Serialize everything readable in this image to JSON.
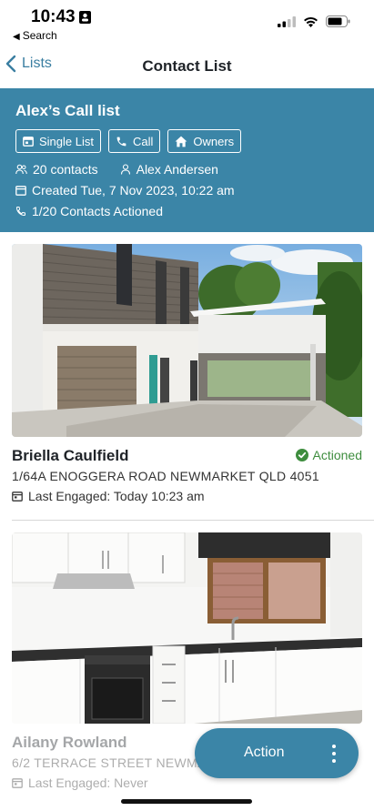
{
  "status_bar": {
    "time": "10:43",
    "back_app": "Search"
  },
  "nav": {
    "back_label": "Lists",
    "title": "Contact List"
  },
  "list_header": {
    "title": "Alex’s Call list",
    "chips": [
      {
        "label": "Single List",
        "icon": "calendar-icon"
      },
      {
        "label": "Call",
        "icon": "phone-icon"
      },
      {
        "label": "Owners",
        "icon": "home-icon"
      }
    ],
    "contacts_count": "20 contacts",
    "owner": "Alex Andersen",
    "created": "Created Tue, 7 Nov 2023, 10:22 am",
    "actioned": "1/20 Contacts Actioned"
  },
  "contacts": [
    {
      "name": "Briella Caulfield",
      "address": "1/64A ENOGGERA ROAD NEWMARKET QLD 4051",
      "last_engaged": "Last Engaged: Today 10:23 am",
      "status": "Actioned",
      "image": "house-exterior-photo"
    },
    {
      "name": "Ailany Rowland",
      "address": "6/2 TERRACE STREET NEWMA",
      "last_engaged": "Last Engaged: Never",
      "image": "kitchen-photo"
    }
  ],
  "fab": {
    "label": "Action"
  },
  "colors": {
    "accent": "#3b85a7",
    "success": "#3e8d3e",
    "nav_link": "#3a7ea1"
  }
}
